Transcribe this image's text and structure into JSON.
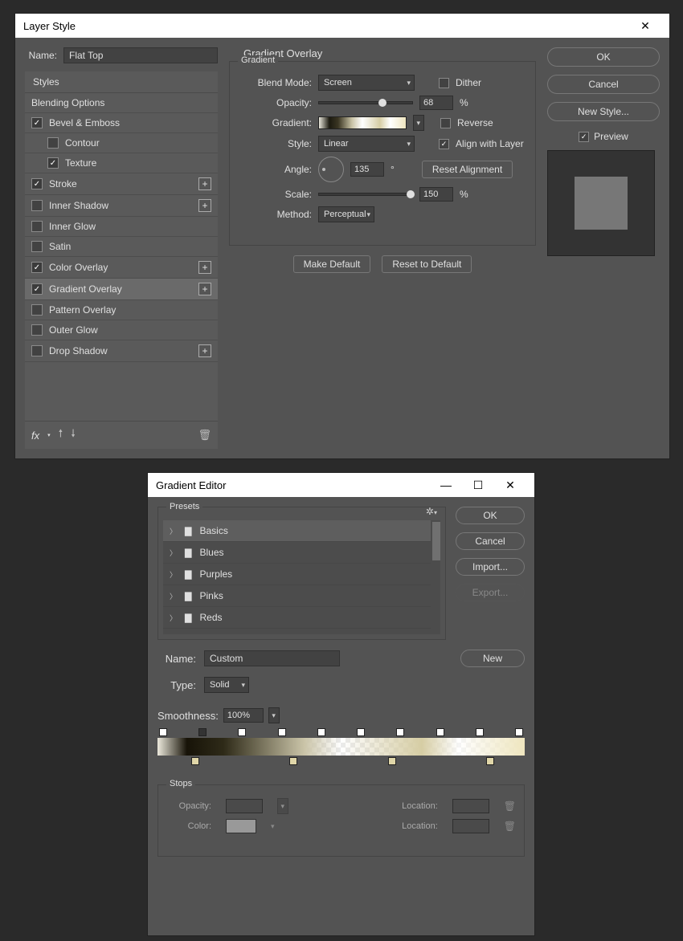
{
  "layerStyle": {
    "title": "Layer Style",
    "nameLabel": "Name:",
    "nameValue": "Flat Top",
    "stylesHeader": "Styles",
    "blendingOptions": "Blending Options",
    "items": [
      {
        "label": "Bevel & Emboss",
        "checked": true,
        "plus": false,
        "indent": false
      },
      {
        "label": "Contour",
        "checked": false,
        "plus": false,
        "indent": true
      },
      {
        "label": "Texture",
        "checked": true,
        "plus": false,
        "indent": true
      },
      {
        "label": "Stroke",
        "checked": true,
        "plus": true,
        "indent": false
      },
      {
        "label": "Inner Shadow",
        "checked": false,
        "plus": true,
        "indent": false
      },
      {
        "label": "Inner Glow",
        "checked": false,
        "plus": false,
        "indent": false
      },
      {
        "label": "Satin",
        "checked": false,
        "plus": false,
        "indent": false
      },
      {
        "label": "Color Overlay",
        "checked": true,
        "plus": true,
        "indent": false
      },
      {
        "label": "Gradient Overlay",
        "checked": true,
        "plus": true,
        "indent": false,
        "selected": true
      },
      {
        "label": "Pattern Overlay",
        "checked": false,
        "plus": false,
        "indent": false
      },
      {
        "label": "Outer Glow",
        "checked": false,
        "plus": false,
        "indent": false
      },
      {
        "label": "Drop Shadow",
        "checked": false,
        "plus": true,
        "indent": false
      }
    ],
    "fx": "fx",
    "panelTitle": "Gradient Overlay",
    "fieldsetLabel": "Gradient",
    "labels": {
      "blendMode": "Blend Mode:",
      "opacity": "Opacity:",
      "gradient": "Gradient:",
      "style": "Style:",
      "angle": "Angle:",
      "scale": "Scale:",
      "method": "Method:",
      "dither": "Dither",
      "reverse": "Reverse",
      "alignLayer": "Align with Layer",
      "degree": "°",
      "percent": "%",
      "resetAlign": "Reset Alignment",
      "makeDefault": "Make Default",
      "resetDefault": "Reset to Default"
    },
    "values": {
      "blendMode": "Screen",
      "opacity": "68",
      "style": "Linear",
      "angle": "135",
      "scale": "150",
      "method": "Perceptual",
      "dither": false,
      "reverse": false,
      "alignLayer": true
    },
    "rightButtons": {
      "ok": "OK",
      "cancel": "Cancel",
      "newStyle": "New Style...",
      "preview": "Preview"
    }
  },
  "gradEditor": {
    "title": "Gradient Editor",
    "presetsLabel": "Presets",
    "presetFolders": [
      "Basics",
      "Blues",
      "Purples",
      "Pinks",
      "Reds"
    ],
    "buttons": {
      "ok": "OK",
      "cancel": "Cancel",
      "import": "Import...",
      "export": "Export...",
      "new": "New"
    },
    "nameLabel": "Name:",
    "nameValue": "Custom",
    "typeLabel": "Type:",
    "typeValue": "Solid",
    "smoothLabel": "Smoothness:",
    "smoothValue": "100%",
    "stopsLabel": "Stops",
    "opacityLabel": "Opacity:",
    "locationLabel": "Location:",
    "colorLabel": "Color:"
  }
}
